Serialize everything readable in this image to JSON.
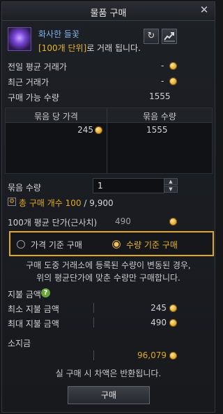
{
  "window": {
    "title": "물품 구매",
    "close_icon": "✕"
  },
  "item": {
    "icon": "purple-flower-icon",
    "name": "화사한 들꽃",
    "desc_hl": "[100개 단위]",
    "desc_rest": "로 거래 됩니다.",
    "refresh_icon": "↻",
    "graph_icon": "trend-chart-icon"
  },
  "stats": {
    "prev_avg_label": "전일 평균 거래가",
    "prev_avg_value": "-",
    "recent_label": "최근 거래가",
    "recent_value": "-",
    "buyable_label": "구매 가능 수량",
    "buyable_value": "1555"
  },
  "table": {
    "col_price": "묶음 당 가격",
    "col_qty": "묶음 수량",
    "rows": [
      {
        "price": "245",
        "qty": "1555"
      }
    ]
  },
  "bundle": {
    "label": "묶음 수량",
    "value": "1",
    "total_label": "총 구매 개수",
    "total_current": "100",
    "total_sep": " / ",
    "total_max": "9,900"
  },
  "avg_price": {
    "label": "100개 평균 단가(근사치)",
    "value": "490"
  },
  "mode": {
    "option_price": "가격 기준 구매",
    "option_qty": "수량 기준 구매",
    "selected": "qty"
  },
  "notice": {
    "line1": "구매 도중 거래소에 등록된 수량이 변동된 경우,",
    "line2": "위의 평균단가에 맞춘 수량만 구매합니다."
  },
  "payment": {
    "title": "지불 금액",
    "help_icon": "?",
    "min_label": "최소 지불 금액",
    "min_value": "245",
    "max_label": "최대 지불 금액",
    "max_value": "490"
  },
  "funds": {
    "title": "소지금",
    "value": "96,079"
  },
  "footer": {
    "refund_note": "실 구매 시 차액은 반환됩니다.",
    "buy_label": "구매"
  }
}
